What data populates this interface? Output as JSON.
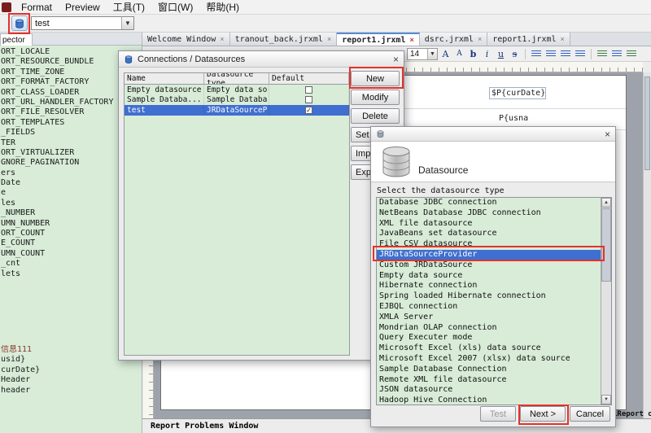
{
  "app": {
    "menu_items": [
      "Format",
      "Preview",
      "工具(T)",
      "窗口(W)",
      "帮助(H)"
    ],
    "toolbar": {
      "datasource_combo_value": "test"
    }
  },
  "inspector": {
    "tab_label": "pector",
    "items_top": [
      {
        "text": "ORT_LOCALE"
      },
      {
        "text": "ORT_RESOURCE_BUNDLE"
      },
      {
        "text": "ORT_TIME_ZONE"
      },
      {
        "text": "ORT_FORMAT_FACTORY"
      },
      {
        "text": "ORT_CLASS_LOADER"
      },
      {
        "text": "ORT_URL_HANDLER_FACTORY"
      },
      {
        "text": "ORT_FILE_RESOLVER"
      },
      {
        "text": "ORT_TEMPLATES"
      },
      {
        "text": "_FIELDS"
      },
      {
        "text": "TER"
      },
      {
        "text": "ORT_VIRTUALIZER"
      },
      {
        "text": "GNORE_PAGINATION"
      },
      {
        "text": "ers"
      },
      {
        "text": "Date"
      },
      {
        "text": "e"
      },
      {
        "text": "les"
      },
      {
        "text": "_NUMBER"
      },
      {
        "text": "UMN_NUMBER"
      },
      {
        "text": "ORT_COUNT"
      },
      {
        "text": "E_COUNT"
      },
      {
        "text": "UMN_COUNT"
      },
      {
        "text": "_cnt"
      },
      {
        "text": "lets"
      }
    ],
    "items_bottom": [
      {
        "text": "信息111",
        "color": "#8c3a2e"
      },
      {
        "text": "usid}"
      },
      {
        "text": "curDate}"
      },
      {
        "text": "Header"
      },
      {
        "text": "header"
      }
    ]
  },
  "tabs": [
    {
      "label": "Welcome Window",
      "close": "×"
    },
    {
      "label": "tranout_back.jrxml",
      "close": "×"
    },
    {
      "label": "report1.jrxml",
      "close": "×",
      "active": true
    },
    {
      "label": "dsrc.jrxml",
      "close": "×"
    },
    {
      "label": "report1.jrxml",
      "close": "×"
    }
  ],
  "format_toolbar": {
    "font_size": "14",
    "grow": "A",
    "shrink": "A",
    "bold": "b",
    "italic": "i",
    "underline": "u",
    "strike": "s"
  },
  "canvas": {
    "field_1": "$P{curDate}",
    "field_2": "P{usna"
  },
  "connections_dialog": {
    "title": "Connections / Datasources",
    "close": "×",
    "columns": [
      "Name",
      "Datasource type",
      "Default"
    ],
    "rows": [
      {
        "name": "Empty datasource",
        "type": "Empty data so...",
        "default_mark": ""
      },
      {
        "name": "Sample Databa...",
        "type": "Sample Databa...",
        "default_mark": ""
      },
      {
        "name": "test",
        "type": "JRDataSourceP...",
        "default_mark": "✓",
        "selected": true
      }
    ],
    "buttons": [
      {
        "label": "New"
      },
      {
        "label": "Modify"
      },
      {
        "label": "Delete"
      },
      {
        "label": "Set",
        "cut": true
      },
      {
        "label": "Imp",
        "cut": true
      },
      {
        "label": "Exp",
        "cut": true
      }
    ]
  },
  "datasource_dialog": {
    "close": "×",
    "header_title": "Datasource",
    "select_label": "Select the datasource type",
    "types": [
      {
        "text": "Database JDBC connection"
      },
      {
        "text": "NetBeans Database JDBC connection"
      },
      {
        "text": "XML file datasource"
      },
      {
        "text": "JavaBeans set datasource"
      },
      {
        "text": "File CSV datasource"
      },
      {
        "text": "JRDataSourceProvider",
        "selected": true
      },
      {
        "text": "Custom JRDataSource"
      },
      {
        "text": "Empty data source"
      },
      {
        "text": "Hibernate connection"
      },
      {
        "text": "Spring loaded Hibernate connection"
      },
      {
        "text": "EJBQL connection"
      },
      {
        "text": "XMLA Server"
      },
      {
        "text": "Mondrian OLAP connection"
      },
      {
        "text": "Query Executer mode"
      },
      {
        "text": "Microsoft Excel (xls) data source"
      },
      {
        "text": "Microsoft Excel 2007 (xlsx) data source"
      },
      {
        "text": "Sample Database Connection"
      },
      {
        "text": "Remote XML file datasource"
      },
      {
        "text": "JSON datasource"
      },
      {
        "text": "Hadoop Hive Connection"
      }
    ],
    "test_button": "Test",
    "next_button": "Next >",
    "cancel_button": "Cancel"
  },
  "bottom": {
    "problems_title": "Report Problems Window",
    "output_title": "iReport outp"
  }
}
